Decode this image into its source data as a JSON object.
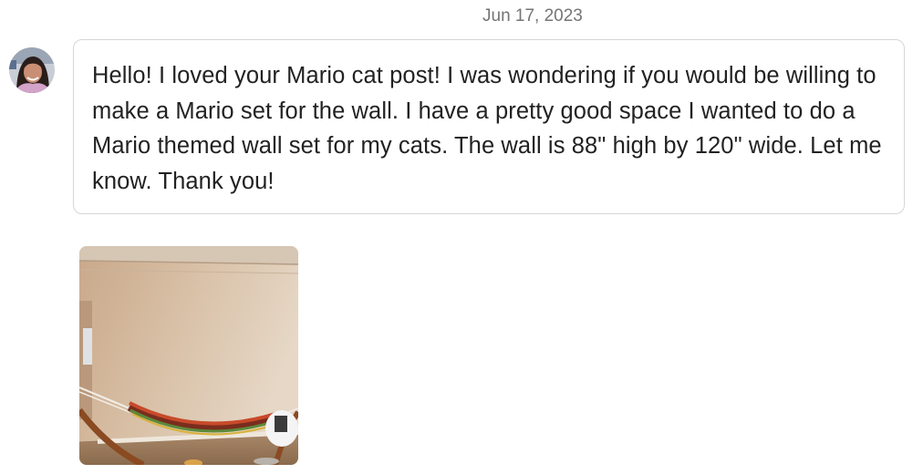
{
  "conversation": {
    "date": "Jun 17, 2023",
    "message": {
      "sender_avatar_icon": "user-avatar-icon",
      "text": "Hello! I loved your Mario cat post! I was wondering if you would be willing to make a Mario set for the wall. I have a pretty good space I wanted to do a Mario themed wall set for my cats. The wall is 88\" high by 120\" wide. Let me know. Thank you!"
    },
    "attachment": {
      "kind": "photo",
      "icon": "photo-thumbnail-icon"
    }
  },
  "colors": {
    "date_text": "#757575",
    "message_text": "#222222",
    "bubble_border": "#d6d6d6",
    "background": "#ffffff"
  }
}
